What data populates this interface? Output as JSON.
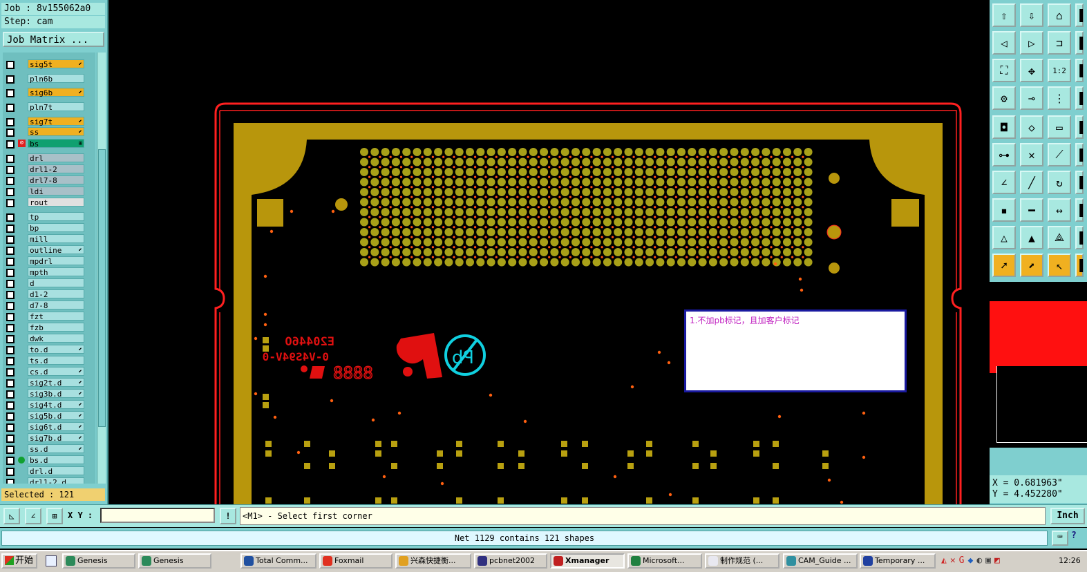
{
  "job_header": {
    "job": "Job : 8v155062a0",
    "step": "Step: cam"
  },
  "job_matrix_label": "Job Matrix ...",
  "layers": [
    {
      "name": "sig5t",
      "kind": "sig",
      "mark": "⬋"
    },
    {
      "name": "pln6b",
      "kind": "normal",
      "mark": ""
    },
    {
      "name": "sig6b",
      "kind": "sig",
      "mark": "⬋"
    },
    {
      "name": "pln7t",
      "kind": "normal",
      "mark": ""
    },
    {
      "name": "sig7t",
      "kind": "sig",
      "mark": "⬋"
    },
    {
      "name": "ss",
      "kind": "sig",
      "mark": "⬋"
    },
    {
      "name": "bs",
      "kind": "bs",
      "mark": "⊞"
    },
    {
      "name": "drl",
      "kind": "drl",
      "mark": ""
    },
    {
      "name": "drl1-2",
      "kind": "drl",
      "mark": ""
    },
    {
      "name": "drl7-8",
      "kind": "drl",
      "mark": ""
    },
    {
      "name": "ldi",
      "kind": "drl",
      "mark": ""
    },
    {
      "name": "rout",
      "kind": "rout",
      "mark": ""
    },
    {
      "name": "tp",
      "kind": "normal",
      "mark": ""
    },
    {
      "name": "bp",
      "kind": "normal",
      "mark": ""
    },
    {
      "name": "mill",
      "kind": "normal",
      "mark": ""
    },
    {
      "name": "outline",
      "kind": "normal",
      "mark": "⬋"
    },
    {
      "name": "mpdrl",
      "kind": "normal",
      "mark": ""
    },
    {
      "name": "mpth",
      "kind": "normal",
      "mark": ""
    },
    {
      "name": "d",
      "kind": "normal",
      "mark": ""
    },
    {
      "name": "d1-2",
      "kind": "normal",
      "mark": ""
    },
    {
      "name": "d7-8",
      "kind": "normal",
      "mark": ""
    },
    {
      "name": "fzt",
      "kind": "normal",
      "mark": ""
    },
    {
      "name": "fzb",
      "kind": "normal",
      "mark": ""
    },
    {
      "name": "dwk",
      "kind": "normal",
      "mark": ""
    },
    {
      "name": "to.d",
      "kind": "normal",
      "mark": "⬋"
    },
    {
      "name": "ts.d",
      "kind": "normal",
      "mark": ""
    },
    {
      "name": "cs.d",
      "kind": "normal",
      "mark": "⬋"
    },
    {
      "name": "sig2t.d",
      "kind": "normal",
      "mark": "⬋"
    },
    {
      "name": "sig3b.d",
      "kind": "normal",
      "mark": "⬋"
    },
    {
      "name": "sig4t.d",
      "kind": "normal",
      "mark": "⬋"
    },
    {
      "name": "sig5b.d",
      "kind": "normal",
      "mark": "⬋"
    },
    {
      "name": "sig6t.d",
      "kind": "normal",
      "mark": "⬋"
    },
    {
      "name": "sig7b.d",
      "kind": "normal",
      "mark": "⬋"
    },
    {
      "name": "ss.d",
      "kind": "normal",
      "mark": "⬋"
    },
    {
      "name": "bs.d",
      "kind": "normal",
      "mark": ""
    },
    {
      "name": "drl.d",
      "kind": "normal",
      "mark": ""
    },
    {
      "name": "drl1-2.d",
      "kind": "normal",
      "mark": ""
    }
  ],
  "selected_status": "Selected : 121",
  "board_text": {
    "part_number": "E20446O",
    "rating": "0-V4S94V-0",
    "date_code": "8888"
  },
  "note_text": "1.不加pb标记，且加客户标记",
  "coords": {
    "x": "X = 0.681963\"",
    "y": "Y = 4.452280\""
  },
  "command": {
    "xy_label": "X Y :",
    "xy_value": "",
    "prompt": "<M1> - Select first corner",
    "units": "Inch"
  },
  "status_message": "Net 1129 contains 121 shapes",
  "taskbar": {
    "start": "开始",
    "tasks": [
      "Genesis",
      "Genesis",
      "Total Comm...",
      "Foxmail",
      "兴森快捷衡...",
      "pcbnet2002",
      "Xmanager",
      "Microsoft...",
      "制作规范 (...",
      "CAM_Guide ...",
      "Temporary ..."
    ],
    "clock": "12:26"
  },
  "colors": {
    "panel": "#7fcfcf",
    "board_copper": "#b8960c",
    "outline": "#ff2020",
    "marking": "#e01010",
    "pb_logo": "#10d0e0"
  }
}
